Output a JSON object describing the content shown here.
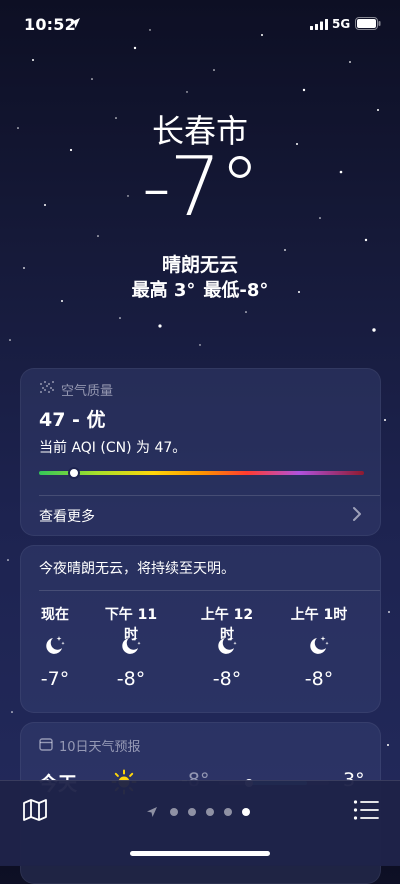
{
  "status_bar": {
    "time": "10:52",
    "network": "5G"
  },
  "header": {
    "city": "长春市",
    "temperature": "-7°",
    "condition": "晴朗无云",
    "high": "最高 3°",
    "low": "最低-8°"
  },
  "air_quality": {
    "title": "空气质量",
    "value": "47 - 优",
    "description": "当前 AQI (CN) 为 47。",
    "index_fraction": 0.1,
    "more_label": "查看更多"
  },
  "hourly": {
    "summary": "今夜晴朗无云，将持续至天明。",
    "items": [
      {
        "time": "现在",
        "icon": "moon-stars-icon",
        "temp": "-7°"
      },
      {
        "time": "下午 11时",
        "icon": "moon-stars-icon",
        "temp": "-8°"
      },
      {
        "time": "上午 12时",
        "icon": "moon-stars-icon",
        "temp": "-8°"
      },
      {
        "time": "上午 1时",
        "icon": "moon-stars-icon",
        "temp": "-8°"
      }
    ]
  },
  "ten_day": {
    "title": "10日天气预报",
    "rows": [
      {
        "day": "今天",
        "icon": "sun-icon",
        "low": "-8°",
        "high": "3°"
      }
    ]
  },
  "bottom_bar": {
    "map_icon": "map-icon",
    "list_icon": "list-icon",
    "page_count": 5,
    "current_page": 5
  },
  "colors": {
    "aqi_good": "#34c759",
    "temp_bar": "#5ac8fa",
    "background": "#161a3a"
  }
}
